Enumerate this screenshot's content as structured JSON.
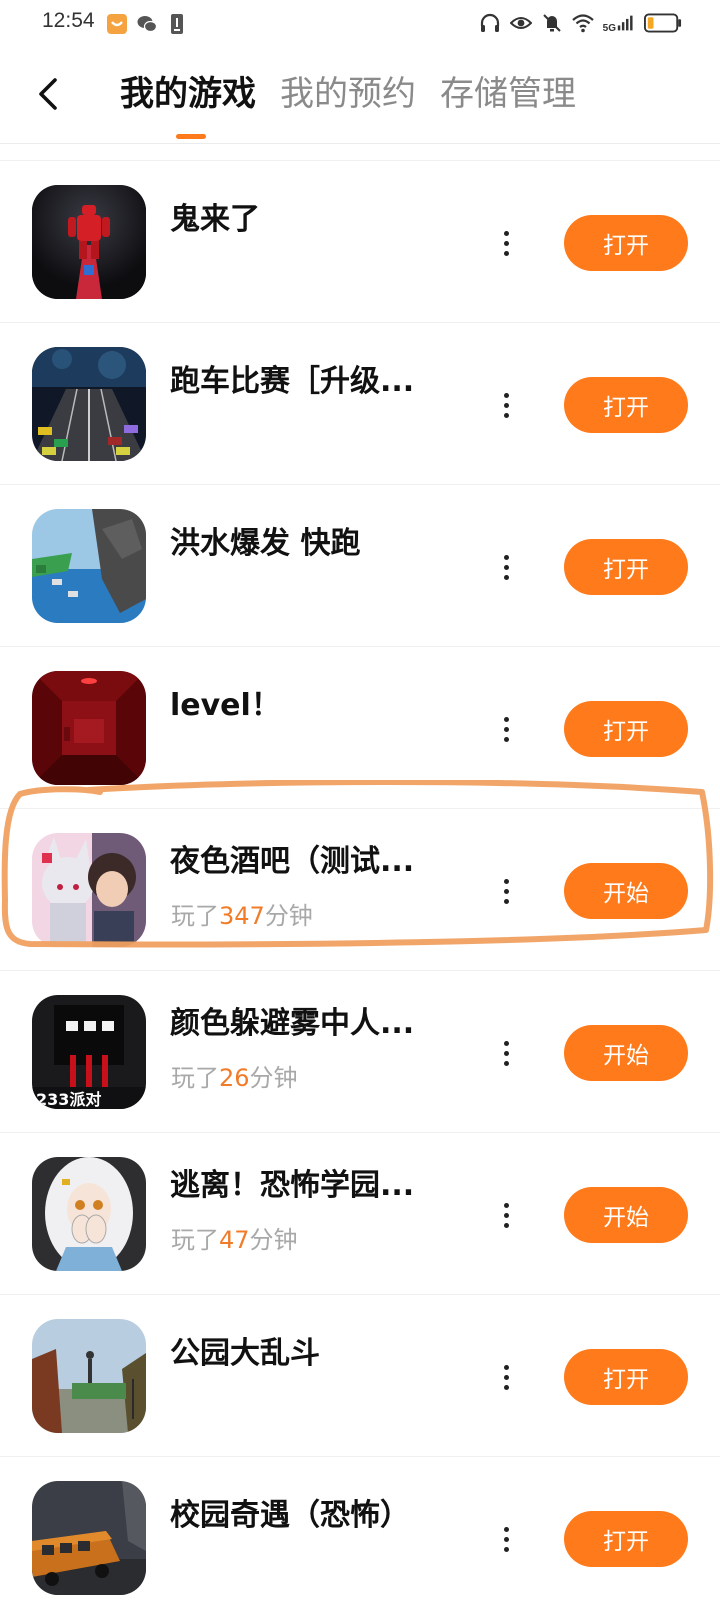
{
  "status_bar": {
    "time": "12:54",
    "network_label": "5G",
    "icons": [
      "app-notification-icon",
      "wechat-icon",
      "download-icon",
      "headphones-icon",
      "eye-icon",
      "mute-icon",
      "wifi-icon",
      "signal-icon",
      "battery-icon"
    ]
  },
  "header": {
    "back_icon": "chevron-left-icon",
    "tabs": [
      {
        "label": "我的游戏",
        "active": true
      },
      {
        "label": "我的预约",
        "active": false
      },
      {
        "label": "存储管理",
        "active": false
      }
    ]
  },
  "colors": {
    "accent": "#ff7a1a",
    "playtime_minutes": "#f07c2a",
    "annotation_stroke": "#f0a060"
  },
  "games": [
    {
      "title": "鬼来了",
      "action": "打开",
      "icon": "red-figure-game-icon"
    },
    {
      "title": "跑车比赛［升级...",
      "action": "打开",
      "icon": "racing-game-icon"
    },
    {
      "title": "洪水爆发  快跑",
      "action": "打开",
      "icon": "flood-game-icon"
    },
    {
      "title": "level！",
      "action": "打开",
      "icon": "red-room-game-icon"
    },
    {
      "title": "夜色酒吧（测试...",
      "action": "开始",
      "icon": "anime-couple-game-icon",
      "playtime": {
        "prefix": "玩了",
        "minutes": "347",
        "suffix": "分钟"
      },
      "highlighted": true
    },
    {
      "title": "颜色躲避雾中人...",
      "action": "开始",
      "icon": "dark-monster-game-icon",
      "icon_text": "233派对",
      "playtime": {
        "prefix": "玩了",
        "minutes": "26",
        "suffix": "分钟"
      }
    },
    {
      "title": "逃离！恐怖学园...",
      "action": "开始",
      "icon": "anime-girl-game-icon",
      "playtime": {
        "prefix": "玩了",
        "minutes": "47",
        "suffix": "分钟"
      }
    },
    {
      "title": "公园大乱斗",
      "action": "打开",
      "icon": "park-game-icon"
    },
    {
      "title": "校园奇遇（恐怖）",
      "action": "打开",
      "icon": "school-bus-game-icon"
    }
  ]
}
